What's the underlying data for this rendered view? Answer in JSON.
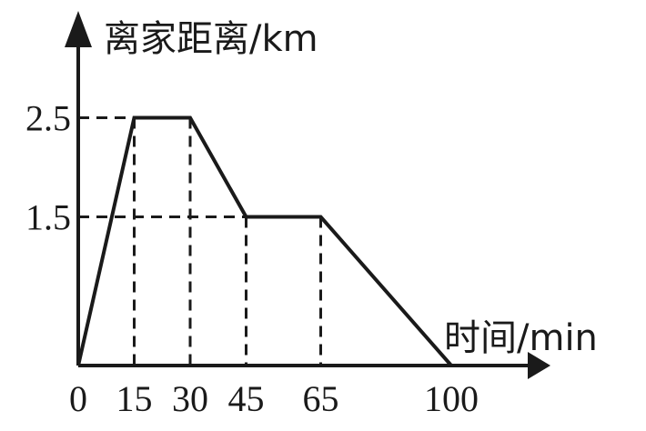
{
  "chart_data": {
    "type": "line",
    "title": "",
    "ylabel": "离家距离/km",
    "xlabel": "时间/min",
    "x": [
      0,
      15,
      30,
      45,
      65,
      100
    ],
    "y": [
      0,
      2.5,
      2.5,
      1.5,
      1.5,
      0
    ],
    "x_ticks": [
      "0",
      "15",
      "30",
      "45",
      "65",
      "100"
    ],
    "y_ticks": [
      "2.5",
      "1.5"
    ],
    "grid": false,
    "legend": "none",
    "color": "#1a1a1a"
  }
}
